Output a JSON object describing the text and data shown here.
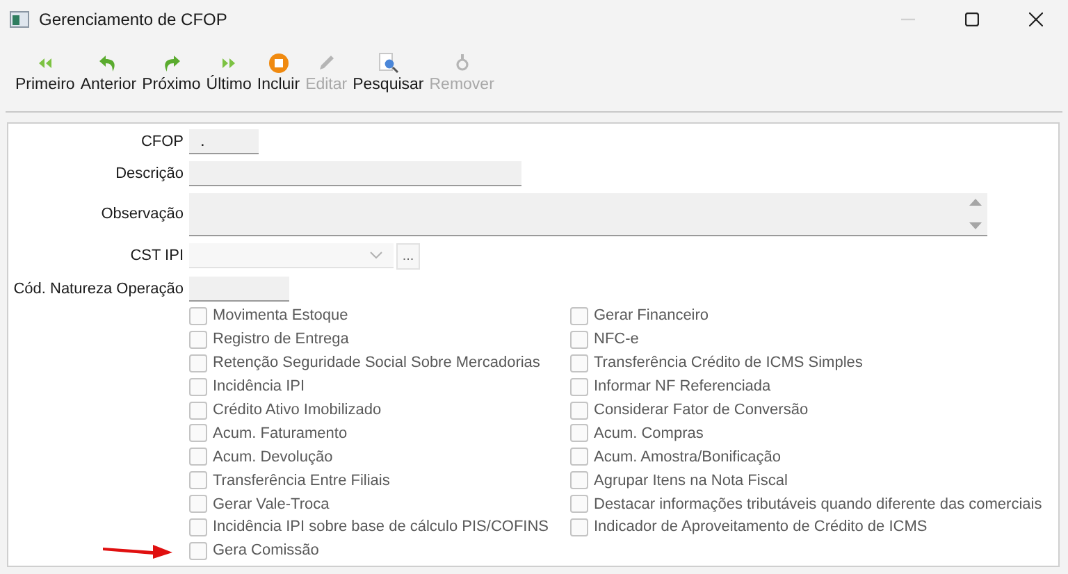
{
  "window": {
    "title": "Gerenciamento de CFOP",
    "controls": [
      {
        "kind": "minimize",
        "disabled": true
      },
      {
        "kind": "maximize",
        "disabled": false
      },
      {
        "kind": "close",
        "disabled": false
      }
    ]
  },
  "toolbar": [
    {
      "kind": "first",
      "label": "Primeiro",
      "disabled": false
    },
    {
      "kind": "previous",
      "label": "Anterior",
      "disabled": false
    },
    {
      "kind": "next",
      "label": "Próximo",
      "disabled": false
    },
    {
      "kind": "last",
      "label": "Último",
      "disabled": false
    },
    {
      "kind": "add",
      "label": "Incluir",
      "disabled": false
    },
    {
      "kind": "edit",
      "label": "Editar",
      "disabled": true
    },
    {
      "kind": "search",
      "label": "Pesquisar",
      "disabled": false
    },
    {
      "kind": "remove",
      "label": "Remover",
      "disabled": true
    }
  ],
  "form": {
    "fields": [
      {
        "kind": "short",
        "label": "CFOP",
        "value": "."
      },
      {
        "kind": "long",
        "label": "Descrição"
      },
      {
        "kind": "textarea",
        "label": "Observação"
      },
      {
        "kind": "combo",
        "label": "CST IPI",
        "button": "..."
      },
      {
        "kind": "medium",
        "label": "Cód. Natureza Operação"
      }
    ],
    "checkboxes_left": [
      {
        "label": "Movimenta Estoque",
        "checked": false
      },
      {
        "label": "Registro de Entrega",
        "checked": false
      },
      {
        "label": "Retenção Seguridade Social Sobre Mercadorias",
        "checked": false
      },
      {
        "label": "Incidência IPI",
        "checked": false
      },
      {
        "label": "Crédito Ativo Imobilizado",
        "checked": false
      },
      {
        "label": "Acum. Faturamento",
        "checked": false
      },
      {
        "label": "Acum. Devolução",
        "checked": false
      },
      {
        "label": "Transferência Entre Filiais",
        "checked": false
      },
      {
        "label": "Gerar Vale-Troca",
        "checked": false
      },
      {
        "label": "Incidência IPI sobre base de cálculo PIS/COFINS",
        "checked": false
      },
      {
        "label": "Gera Comissão",
        "checked": false,
        "highlighted": true
      }
    ],
    "checkboxes_right": [
      {
        "label": "Gerar Financeiro",
        "checked": false
      },
      {
        "label": "NFC-e",
        "checked": false
      },
      {
        "label": "Transferência Crédito de ICMS Simples",
        "checked": false
      },
      {
        "label": "Informar NF Referenciada",
        "checked": false
      },
      {
        "label": "Considerar Fator de Conversão",
        "checked": false
      },
      {
        "label": "Acum. Compras",
        "checked": false
      },
      {
        "label": "Acum. Amostra/Bonificação",
        "checked": false
      },
      {
        "label": "Agrupar Itens na Nota Fiscal",
        "checked": false
      },
      {
        "label": "Destacar informações tributáveis quando diferente das comerciais",
        "checked": false
      },
      {
        "label": "Indicador de Aproveitamento de Crédito de ICMS",
        "checked": false
      }
    ]
  }
}
